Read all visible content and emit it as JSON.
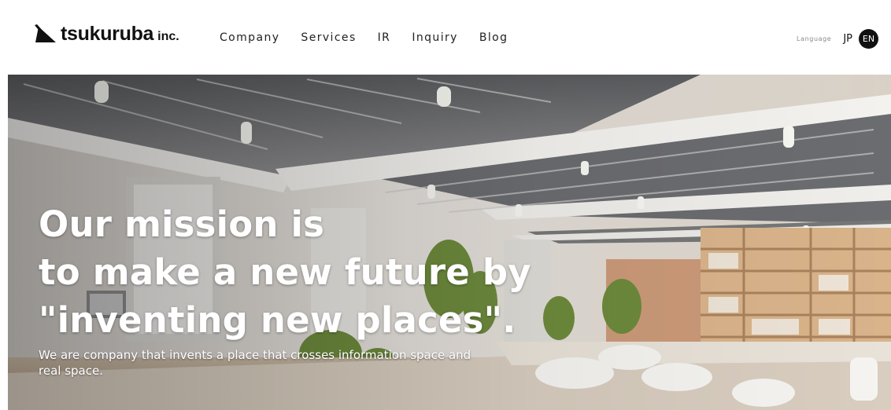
{
  "header": {
    "logo": {
      "name": "tsukuruba",
      "suffix": "inc."
    },
    "nav": [
      {
        "label": "Company"
      },
      {
        "label": "Services"
      },
      {
        "label": "IR"
      },
      {
        "label": "Inquiry"
      },
      {
        "label": "Blog"
      }
    ],
    "language": {
      "label": "Language",
      "options": [
        "JP",
        "EN"
      ],
      "selected": "EN"
    }
  },
  "hero": {
    "title_lines": [
      "Our mission is",
      "to make a new future by",
      "\"inventing new places\"."
    ],
    "subtitle": "We are company that invents a place that crosses information space and real space.",
    "image": "office-interior-photo"
  },
  "colors": {
    "text": "#111111",
    "active_badge": "#111111",
    "hero_text": "#ffffff"
  }
}
